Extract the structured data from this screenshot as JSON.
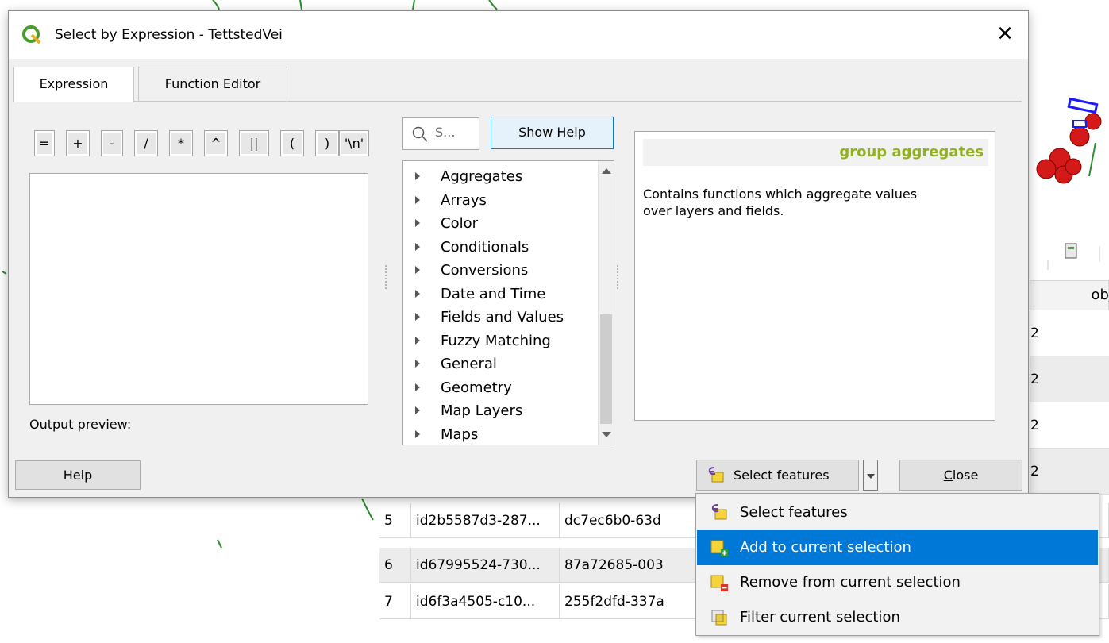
{
  "dialog": {
    "title": "Select by Expression - TettstedVei",
    "close_glyph": "✕"
  },
  "tabs": [
    {
      "label": "Expression",
      "active": true
    },
    {
      "label": "Function Editor",
      "active": false
    }
  ],
  "operators": [
    "=",
    "+",
    "-",
    "/",
    "*",
    "^",
    "||",
    "(",
    ")",
    "'\\n'"
  ],
  "expression": {
    "value": "",
    "output_preview_label": "Output preview:"
  },
  "search": {
    "placeholder": "S..."
  },
  "show_help_label": "Show Help",
  "function_groups": [
    "Aggregates",
    "Arrays",
    "Color",
    "Conditionals",
    "Conversions",
    "Date and Time",
    "Fields and Values",
    "Fuzzy Matching",
    "General",
    "Geometry",
    "Map Layers",
    "Maps"
  ],
  "help_panel": {
    "heading": "group aggregates",
    "heading_color": "#93b023",
    "text": "Contains functions which aggregate values over layers and fields."
  },
  "buttons": {
    "help": "Help",
    "select_features": "Select features",
    "close_prefix": "C",
    "close_rest": "lose"
  },
  "select_menu": {
    "highlight_color": "#0078d7",
    "items": [
      {
        "label": "Select features",
        "icon": "select-features-icon"
      },
      {
        "label": "Add to current selection",
        "icon": "add-to-selection-icon",
        "highlighted": true
      },
      {
        "label": "Remove from current selection",
        "icon": "remove-from-selection-icon"
      },
      {
        "label": "Filter current selection",
        "icon": "filter-selection-icon"
      }
    ]
  },
  "attribute_table": {
    "partial_header": "obj",
    "partial_cells": [
      "2",
      "2",
      "2",
      "2"
    ],
    "rows": [
      {
        "num": "5",
        "id": "id2b5587d3-287...",
        "uuid": "dc7ec6b0-63d"
      },
      {
        "num": "6",
        "id": "id67995524-730...",
        "uuid": "87a72685-003"
      },
      {
        "num": "7",
        "id": "id6f3a4505-c10...",
        "uuid": "255f2dfd-337a"
      }
    ]
  }
}
